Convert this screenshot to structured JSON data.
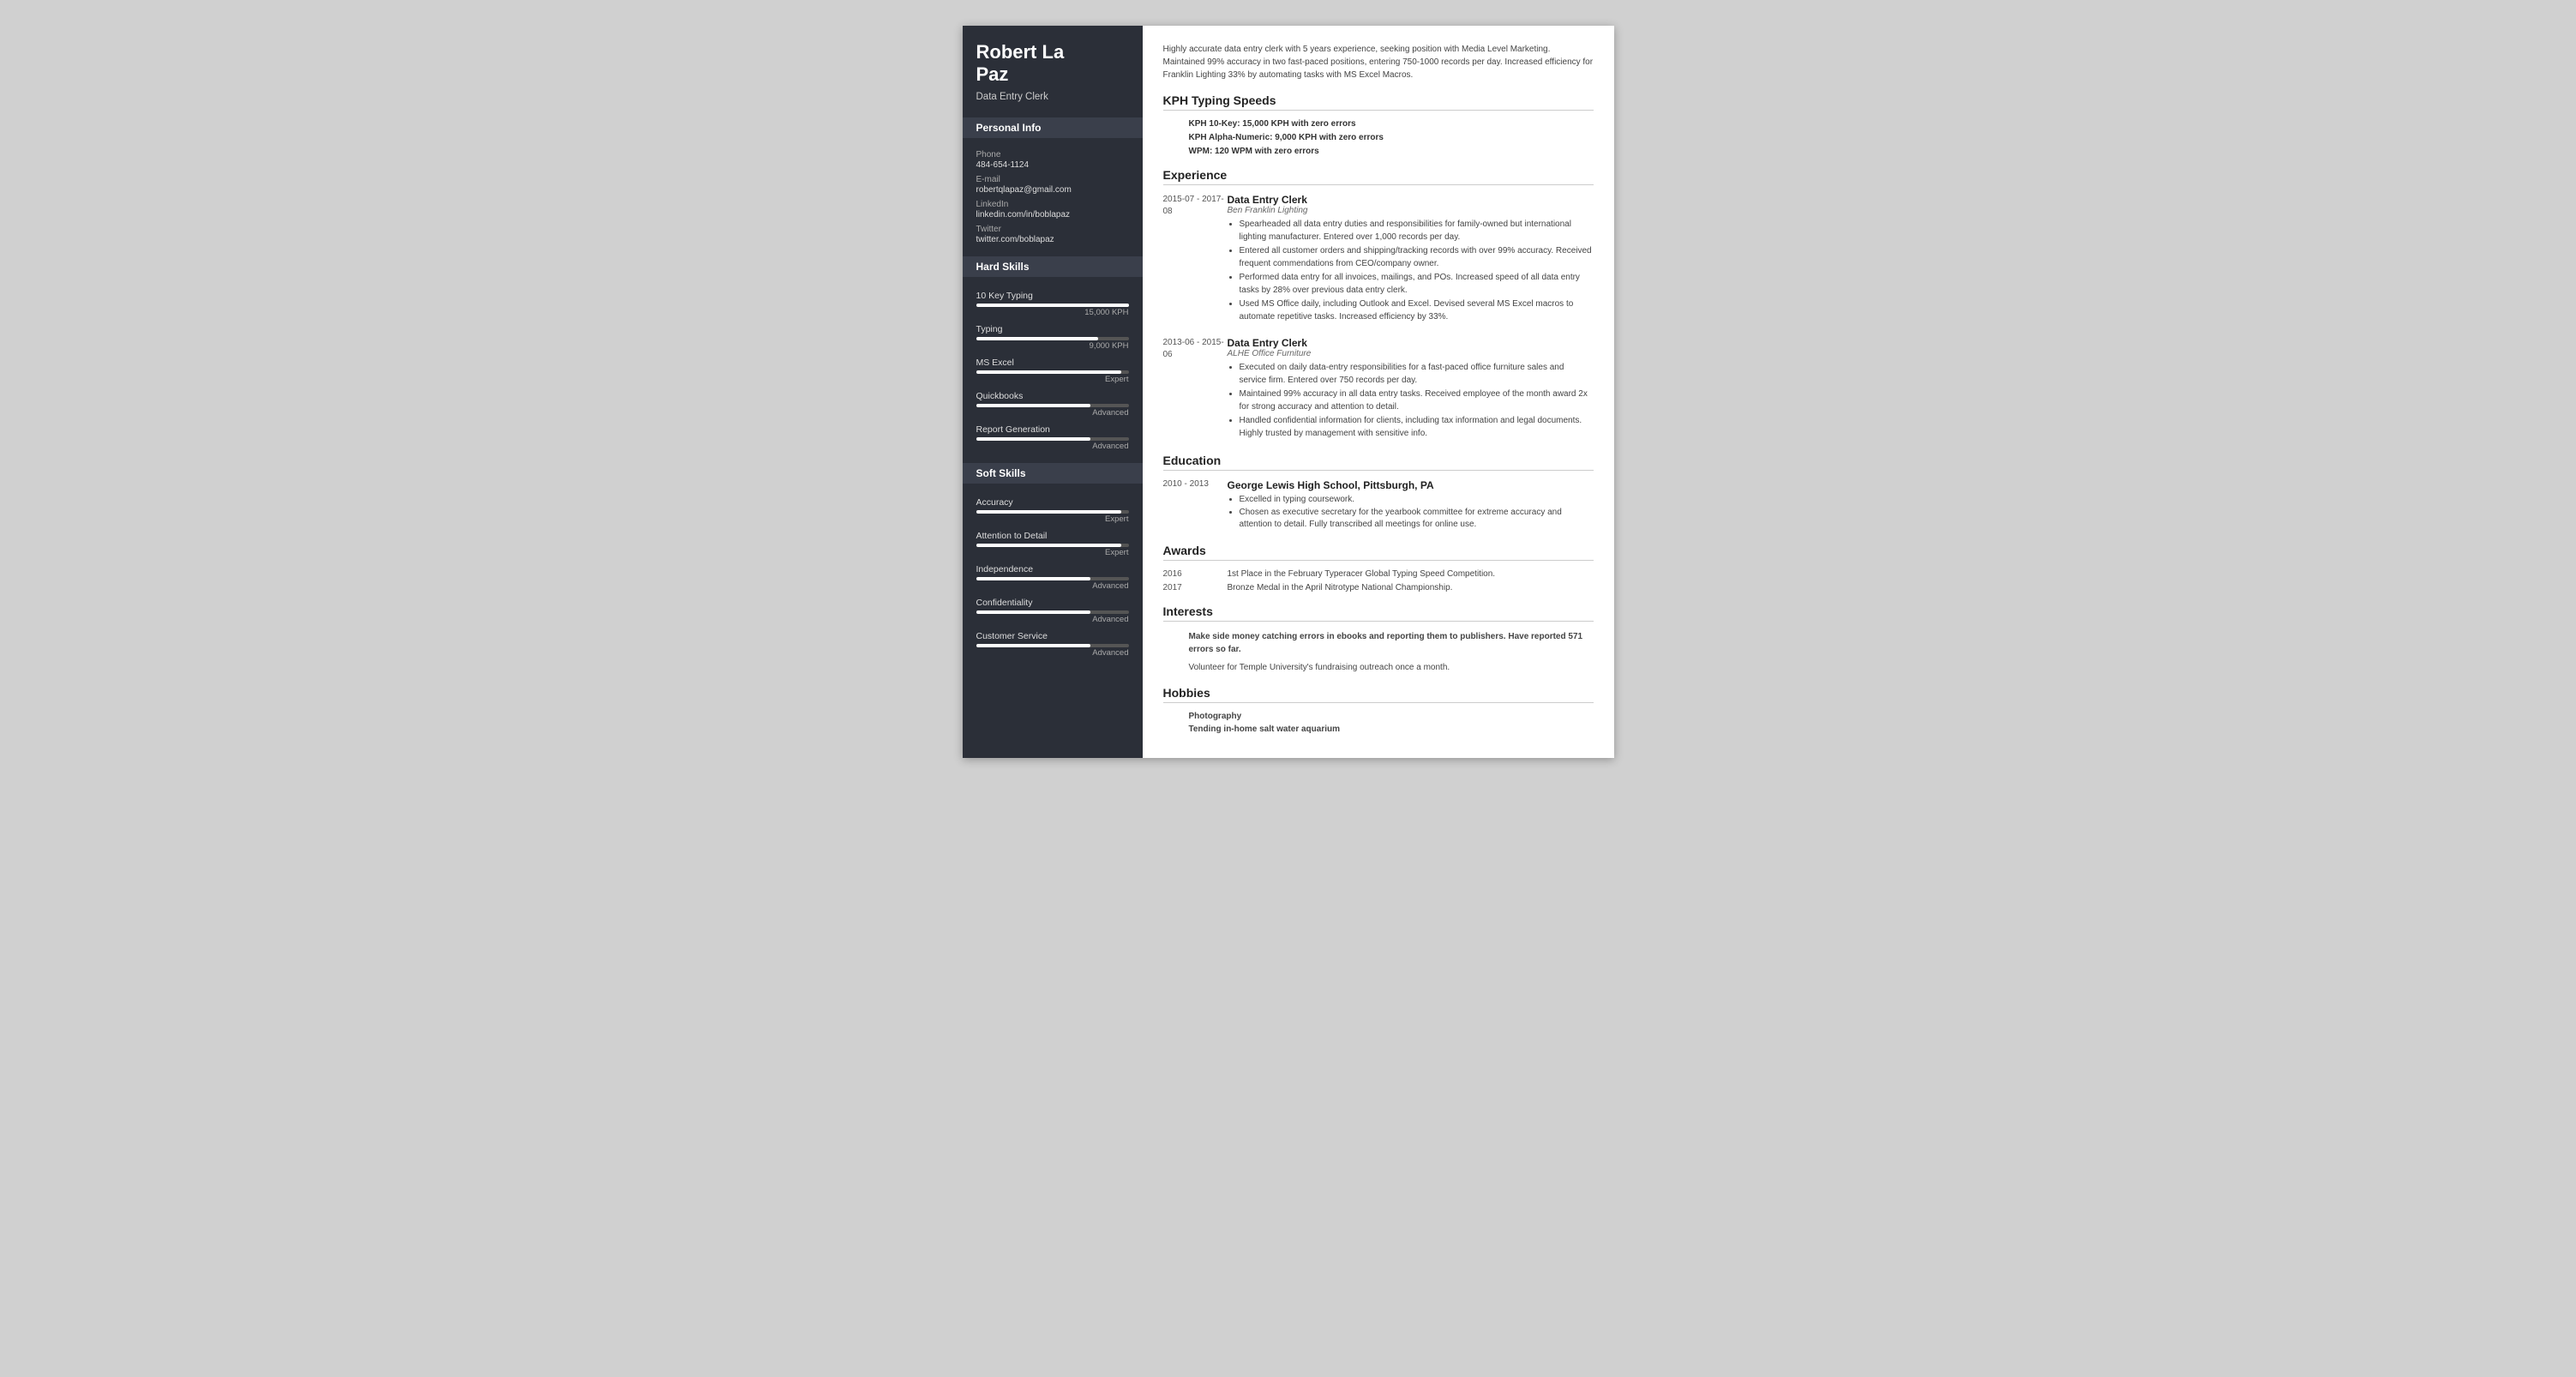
{
  "sidebar": {
    "name_line1": "Robert La",
    "name_line2": "Paz",
    "title": "Data Entry Clerk",
    "sections": {
      "personal_info": {
        "header": "Personal Info",
        "phone_label": "Phone",
        "phone_value": "484-654-1124",
        "email_label": "E-mail",
        "email_value": "robertqlapaz@gmail.com",
        "linkedin_label": "LinkedIn",
        "linkedin_value": "linkedin.com/in/boblapaz",
        "twitter_label": "Twitter",
        "twitter_value": "twitter.com/boblapaz"
      },
      "hard_skills": {
        "header": "Hard Skills",
        "skills": [
          {
            "name": "10 Key Typing",
            "fill_pct": 100,
            "level": "15,000 KPH"
          },
          {
            "name": "Typing",
            "fill_pct": 80,
            "level": "9,000 KPH"
          },
          {
            "name": "MS Excel",
            "fill_pct": 95,
            "level": "Expert"
          },
          {
            "name": "Quickbooks",
            "fill_pct": 75,
            "level": "Advanced"
          },
          {
            "name": "Report Generation",
            "fill_pct": 75,
            "level": "Advanced"
          }
        ]
      },
      "soft_skills": {
        "header": "Soft Skills",
        "skills": [
          {
            "name": "Accuracy",
            "fill_pct": 95,
            "level": "Expert"
          },
          {
            "name": "Attention to Detail",
            "fill_pct": 95,
            "level": "Expert"
          },
          {
            "name": "Independence",
            "fill_pct": 75,
            "level": "Advanced"
          },
          {
            "name": "Confidentiality",
            "fill_pct": 75,
            "level": "Advanced"
          },
          {
            "name": "Customer Service",
            "fill_pct": 75,
            "level": "Advanced"
          }
        ]
      }
    }
  },
  "main": {
    "summary": "Highly accurate data entry clerk with 5 years experience, seeking position with Media Level Marketing. Maintained 99% accuracy in two fast-paced positions, entering 750-1000 records per day. Increased efficiency for Franklin Lighting 33% by automating tasks with MS Excel Macros.",
    "kph_section": {
      "title": "KPH Typing Speeds",
      "items": [
        "KPH 10-Key: 15,000 KPH with zero errors",
        "KPH Alpha-Numeric: 9,000 KPH with zero errors",
        "WPM: 120 WPM with zero errors"
      ]
    },
    "experience": {
      "title": "Experience",
      "entries": [
        {
          "date": "2015-07 - 2017-08",
          "job_title": "Data Entry Clerk",
          "company": "Ben Franklin Lighting",
          "bullets": [
            "Spearheaded all data entry duties and responsibilities for family-owned but international lighting manufacturer. Entered over 1,000 records per day.",
            "Entered all customer orders and shipping/tracking records with over 99% accuracy. Received frequent commendations from CEO/company owner.",
            "Performed data entry for all invoices, mailings, and POs. Increased speed of all data entry tasks by 28% over previous data entry clerk.",
            "Used MS Office daily, including Outlook and Excel. Devised several MS Excel macros to automate repetitive tasks. Increased efficiency by 33%."
          ]
        },
        {
          "date": "2013-06 - 2015-06",
          "job_title": "Data Entry Clerk",
          "company": "ALHE Office Furniture",
          "bullets": [
            "Executed on daily data-entry responsibilities for a fast-paced office furniture sales and service firm. Entered over 750 records per day.",
            "Maintained 99% accuracy in all data entry tasks. Received employee of the month award 2x for strong accuracy and attention to detail.",
            "Handled confidential information for clients, including tax information and legal documents. Highly trusted by management with sensitive info."
          ]
        }
      ]
    },
    "education": {
      "title": "Education",
      "entries": [
        {
          "date": "2010 - 2013",
          "school": "George Lewis High School, Pittsburgh, PA",
          "bullets": [
            "Excelled in typing coursework.",
            "Chosen as executive secretary for the yearbook committee for extreme accuracy and attention to detail. Fully transcribed all meetings for online use."
          ]
        }
      ]
    },
    "awards": {
      "title": "Awards",
      "entries": [
        {
          "year": "2016",
          "text": "1st Place in the February Typeracer Global Typing Speed Competition."
        },
        {
          "year": "2017",
          "text": "Bronze Medal in the April Nitrotype National Championship."
        }
      ]
    },
    "interests": {
      "title": "Interests",
      "items": [
        {
          "bold": true,
          "text": "Make side money catching errors in ebooks and reporting them to publishers. Have reported 571 errors so far."
        },
        {
          "bold": false,
          "text": "Volunteer for Temple University's fundraising outreach once a month."
        }
      ]
    },
    "hobbies": {
      "title": "Hobbies",
      "items": [
        "Photography",
        "Tending in-home salt water aquarium"
      ]
    }
  }
}
